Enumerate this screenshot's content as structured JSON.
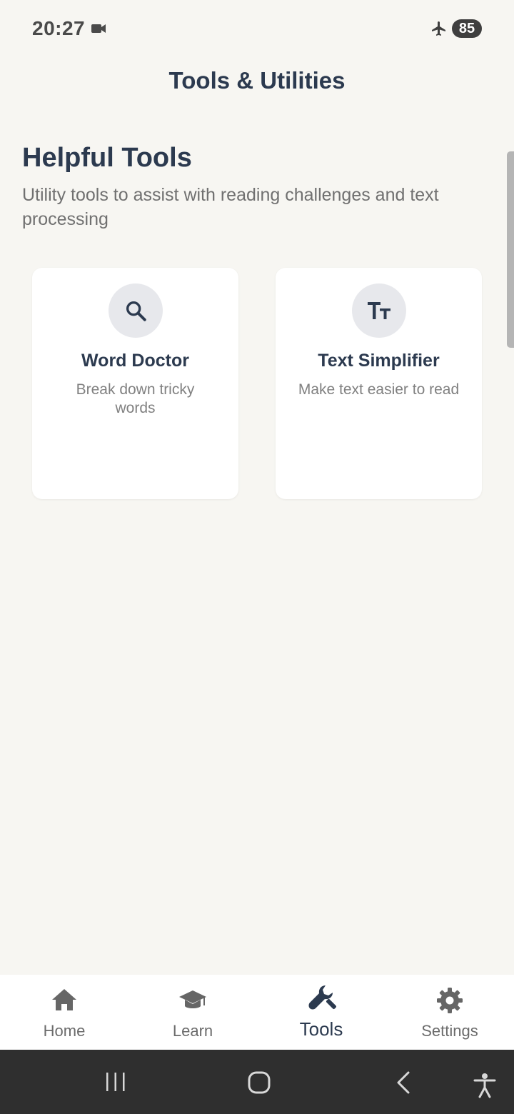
{
  "status_bar": {
    "time": "20:27",
    "battery": "85",
    "icons": [
      "video-camera-icon",
      "airplane-mode-icon"
    ]
  },
  "header": {
    "title": "Tools & Utilities"
  },
  "section": {
    "title": "Helpful Tools",
    "subtitle": "Utility tools to assist with reading challenges and text processing"
  },
  "tools": [
    {
      "title": "Word Doctor",
      "description": "Break down tricky words",
      "icon": "search-icon"
    },
    {
      "title": "Text Simplifier",
      "description": "Make text easier to read",
      "icon": "text-size-icon"
    }
  ],
  "bottom_nav": {
    "items": [
      {
        "label": "Home",
        "icon": "home-icon",
        "active": false
      },
      {
        "label": "Learn",
        "icon": "graduation-cap-icon",
        "active": false
      },
      {
        "label": "Tools",
        "icon": "wrench-icon",
        "active": true
      },
      {
        "label": "Settings",
        "icon": "gear-icon",
        "active": false
      }
    ]
  },
  "colors": {
    "background": "#f7f6f2",
    "primary_text": "#2c3a4f",
    "secondary_text": "#707070",
    "card": "#ffffff",
    "icon_circle": "#e7e8ec",
    "system_nav": "#2f2f2f"
  }
}
